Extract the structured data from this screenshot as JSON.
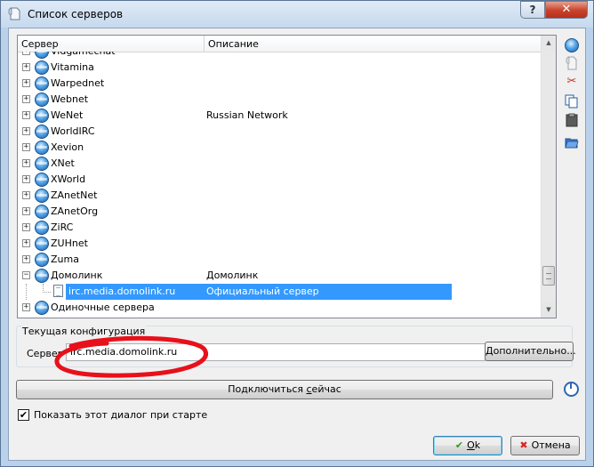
{
  "window": {
    "title": "Список серверов",
    "help_glyph": "?",
    "close_glyph": "✕"
  },
  "tree": {
    "columns": [
      "Сервер",
      "Описание"
    ],
    "rows": [
      {
        "name": "Vidgamechat",
        "desc": ""
      },
      {
        "name": "Vitamina",
        "desc": ""
      },
      {
        "name": "Warpednet",
        "desc": ""
      },
      {
        "name": "Webnet",
        "desc": ""
      },
      {
        "name": "WeNet",
        "desc": "Russian Network"
      },
      {
        "name": "WorldIRC",
        "desc": ""
      },
      {
        "name": "Xevion",
        "desc": ""
      },
      {
        "name": "XNet",
        "desc": ""
      },
      {
        "name": "XWorld",
        "desc": ""
      },
      {
        "name": "ZAnetNet",
        "desc": ""
      },
      {
        "name": "ZAnetOrg",
        "desc": ""
      },
      {
        "name": "ZiRC",
        "desc": ""
      },
      {
        "name": "ZUHnet",
        "desc": ""
      },
      {
        "name": "Zuma",
        "desc": ""
      },
      {
        "name": "Домолинк",
        "desc": "Домолинк",
        "expanded": true
      },
      {
        "name": "irc.media.domolink.ru",
        "desc": "Официальный сервер",
        "child": true,
        "selected": true
      },
      {
        "name": "Одиночные сервера",
        "desc": ""
      }
    ]
  },
  "toolbar": [
    "globe-icon",
    "document-icon",
    "scissors-icon",
    "copy-icon",
    "clipboard-icon",
    "folder-icon"
  ],
  "config": {
    "group_title": "Текущая конфигурация",
    "server_label": "Сервер",
    "server_value": "irc.media.domolink.ru",
    "more_button": "Дополнительно...",
    "annotation_color": "#e8101a"
  },
  "connect_button": {
    "before": "Подключиться ",
    "underlined": "с",
    "after": "ейчас"
  },
  "show_on_start": {
    "label": "Показать этот диалог при старте",
    "checked": true
  },
  "ok_button": {
    "underlined": "O",
    "rest": "k"
  },
  "cancel_button": {
    "label": "Отмена"
  },
  "colors": {
    "selection": "#3399ff",
    "frame": "#b9d1ea"
  }
}
